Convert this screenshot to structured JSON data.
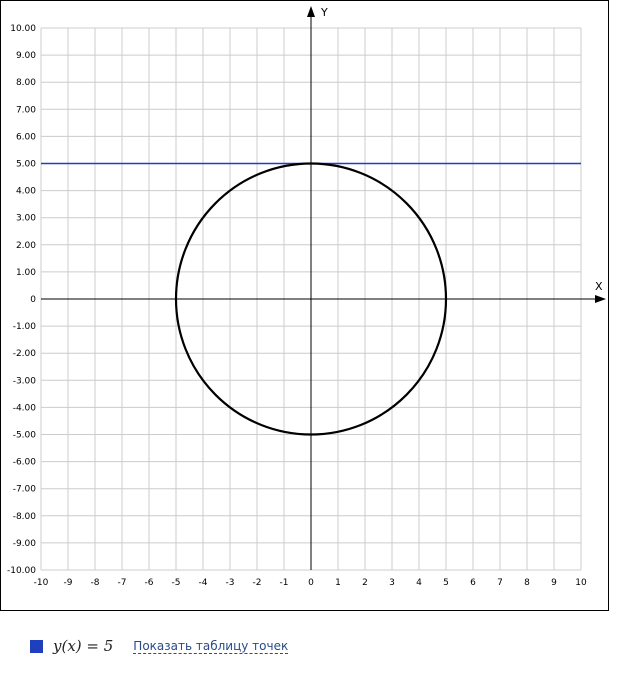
{
  "chart_data": {
    "type": "line",
    "x_axis_label": "X",
    "y_axis_label": "Y",
    "xlim": [
      -10,
      10
    ],
    "ylim": [
      -10,
      10
    ],
    "x_ticks": [
      "-10",
      "-9",
      "-8",
      "-7",
      "-6",
      "-5",
      "-4",
      "-3",
      "-2",
      "-1",
      "0",
      "1",
      "2",
      "3",
      "4",
      "5",
      "6",
      "7",
      "8",
      "9",
      "10"
    ],
    "y_ticks": [
      "10.00",
      "9.00",
      "8.00",
      "7.00",
      "6.00",
      "5.00",
      "4.00",
      "3.00",
      "2.00",
      "1.00",
      "0",
      "-1.00",
      "-2.00",
      "-3.00",
      "-4.00",
      "-5.00",
      "-6.00",
      "-7.00",
      "-8.00",
      "-9.00",
      "-10.00"
    ],
    "grid": true,
    "series": [
      {
        "kind": "horizontal-line",
        "y": 5,
        "color": "#1f3fbf"
      },
      {
        "kind": "circle",
        "center": [
          0,
          0
        ],
        "radius": 5,
        "color": "#000000"
      }
    ]
  },
  "legend": {
    "formula": "y(x) = 5",
    "swatch_color": "#1f3fbf",
    "link_text": "Показать таблицу точек"
  }
}
